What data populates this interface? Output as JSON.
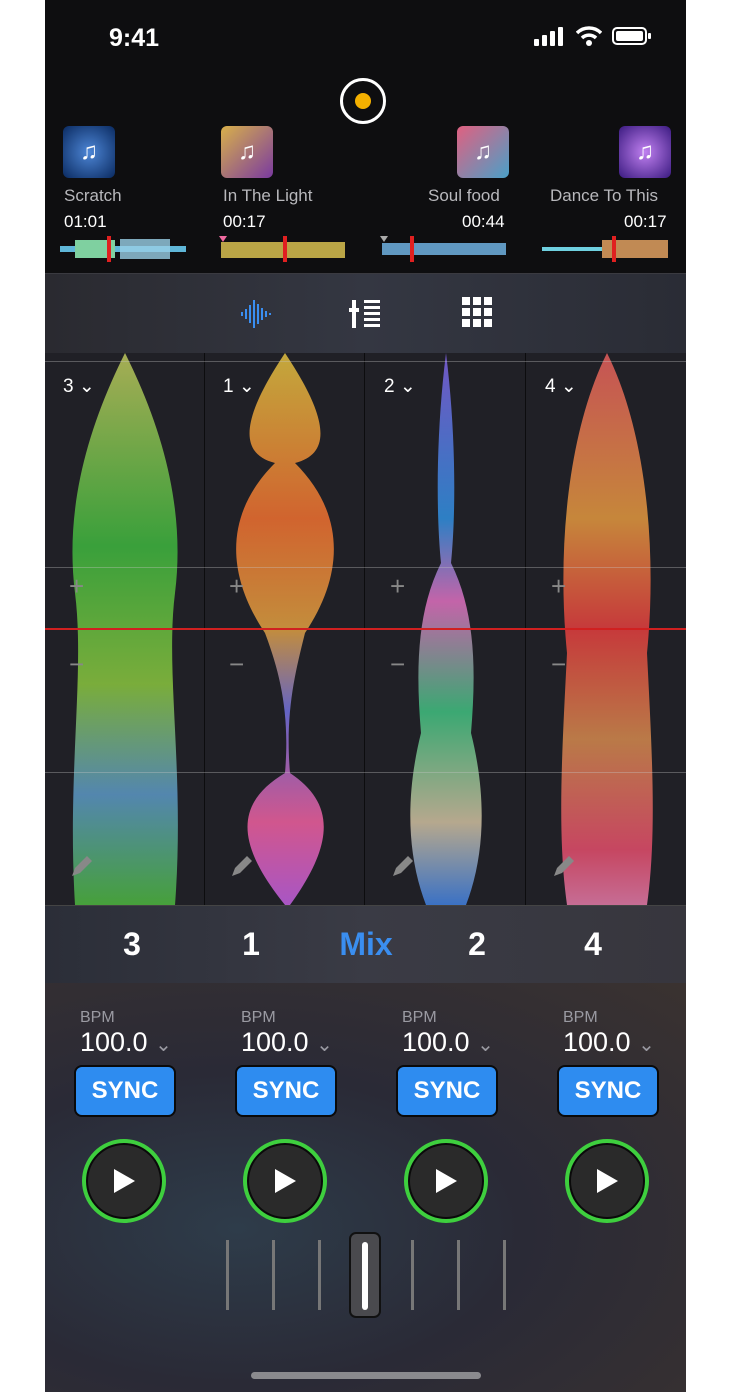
{
  "status_bar": {
    "time": "9:41"
  },
  "tracks": [
    {
      "title": "Scratch",
      "time": "01:01",
      "cover_icon": "music-note-icon",
      "cover_color": "#2a5aa8"
    },
    {
      "title": "In The Light",
      "time": "00:17",
      "cover_icon": "music-note-icon",
      "cover_color": "#c9a23a"
    },
    {
      "title": "Soul food",
      "time": "00:44",
      "cover_icon": "music-note-icon",
      "cover_color": "#d85c7c"
    },
    {
      "title": "Dance To This",
      "time": "00:17",
      "cover_icon": "music-note-icon",
      "cover_color": "#5a2ea8"
    }
  ],
  "view_tabs": [
    "waveform-icon",
    "mixer-icon",
    "pads-grid-icon"
  ],
  "wave_columns": [
    {
      "deck": "3",
      "plus": "+",
      "minus": "−"
    },
    {
      "deck": "1",
      "plus": "+",
      "minus": "−"
    },
    {
      "deck": "2",
      "plus": "+",
      "minus": "−"
    },
    {
      "deck": "4",
      "plus": "+",
      "minus": "−"
    }
  ],
  "deck_bar": {
    "deck_a": "3",
    "deck_b": "1",
    "mix": "Mix",
    "deck_c": "2",
    "deck_d": "4",
    "mix_color": "#3a8ef0"
  },
  "decks": [
    {
      "bpm_label": "BPM",
      "bpm": "100.0",
      "sync": "SYNC"
    },
    {
      "bpm_label": "BPM",
      "bpm": "100.0",
      "sync": "SYNC"
    },
    {
      "bpm_label": "BPM",
      "bpm": "100.0",
      "sync": "SYNC"
    },
    {
      "bpm_label": "BPM",
      "bpm": "100.0",
      "sync": "SYNC"
    }
  ],
  "colors": {
    "sync": "#2e8cf0",
    "play_ring": "#3ecf3e",
    "record_dot": "#f4b000",
    "playhead": "#e02020"
  }
}
